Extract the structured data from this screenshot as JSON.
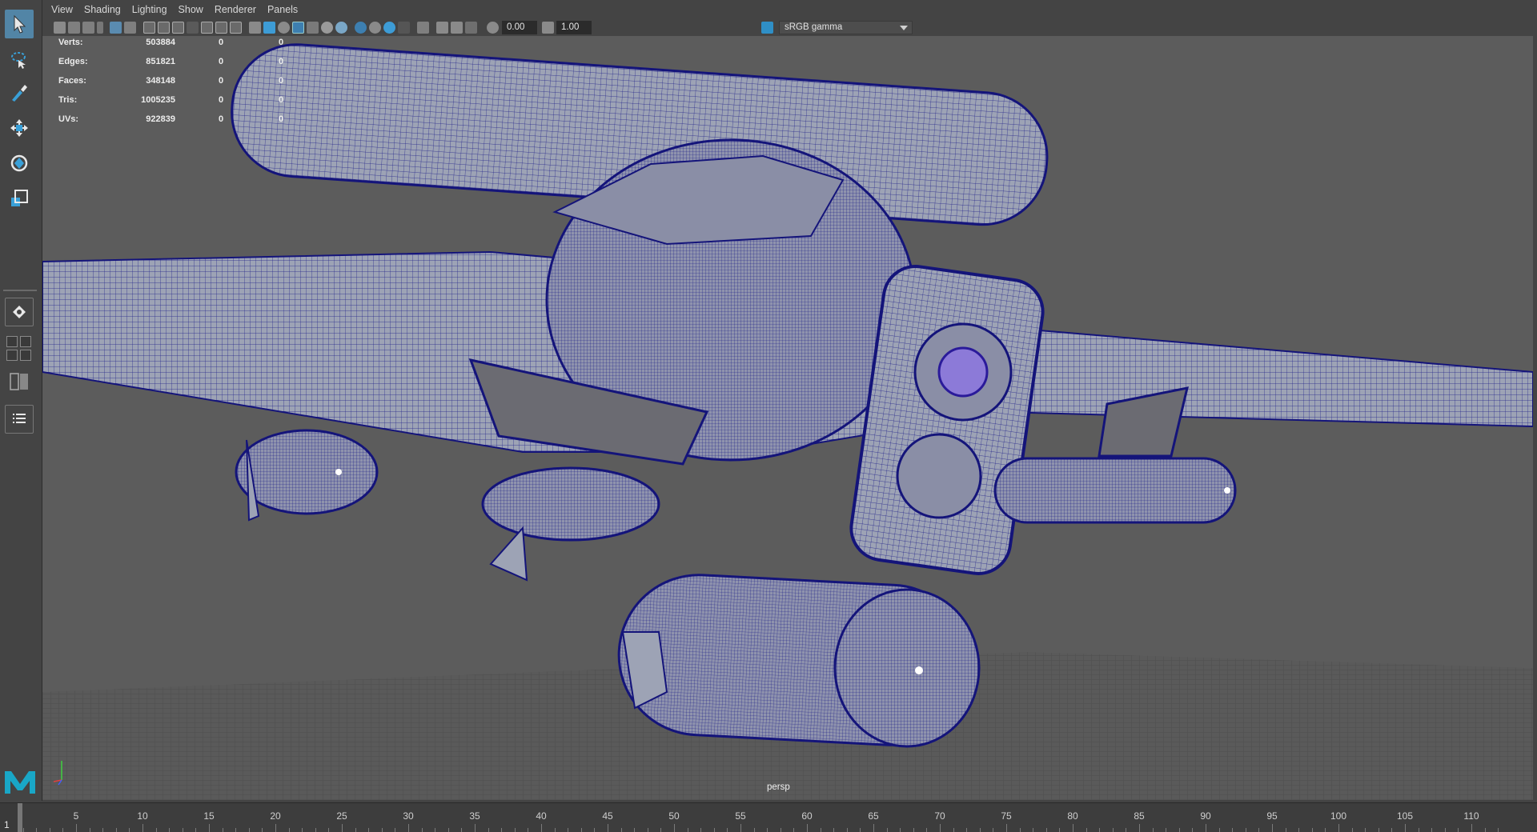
{
  "panel_menu": {
    "items": [
      "View",
      "Shading",
      "Lighting",
      "Show",
      "Renderer",
      "Panels"
    ]
  },
  "toolbar": {
    "exposure_value": "0.00",
    "gamma_value": "1.00",
    "color_space": "sRGB gamma"
  },
  "hud": {
    "rows": [
      {
        "label": "Verts:",
        "v1": "503884",
        "v2": "0",
        "v3": "0"
      },
      {
        "label": "Edges:",
        "v1": "851821",
        "v2": "0",
        "v3": "0"
      },
      {
        "label": "Faces:",
        "v1": "348148",
        "v2": "0",
        "v3": "0"
      },
      {
        "label": "Tris:",
        "v1": "1005235",
        "v2": "0",
        "v3": "0"
      },
      {
        "label": "UVs:",
        "v1": "922839",
        "v2": "0",
        "v3": "0"
      }
    ]
  },
  "viewport": {
    "camera": "persp",
    "wireframe_color": "#1a1a8c",
    "background": "#5c5c5c"
  },
  "timeline": {
    "current_frame": "1",
    "ticks": [
      "5",
      "10",
      "15",
      "20",
      "25",
      "30",
      "35",
      "40",
      "45",
      "50",
      "55",
      "60",
      "65",
      "70",
      "75",
      "80",
      "85",
      "90",
      "95",
      "100",
      "105",
      "110"
    ]
  },
  "colors": {
    "accent": "#5285a6",
    "panel": "#444444",
    "viewport": "#5c5c5c"
  }
}
